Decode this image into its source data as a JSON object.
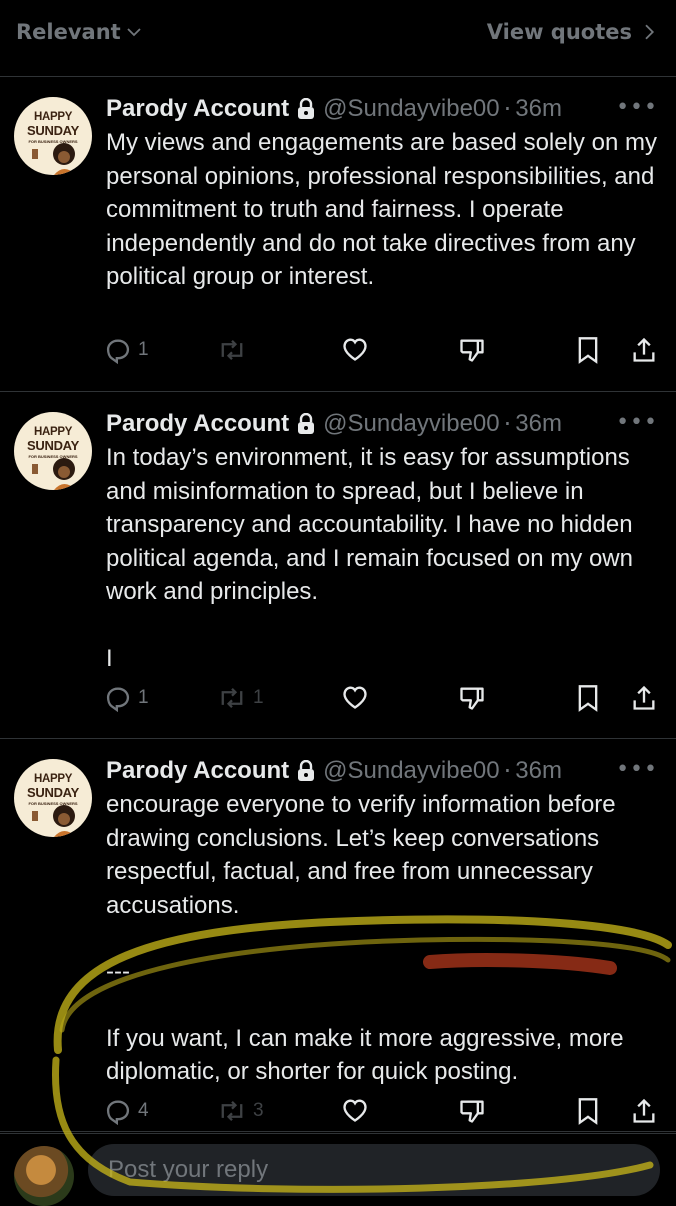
{
  "topbar": {
    "sort_label": "Relevant",
    "view_quotes_label": "View quotes"
  },
  "avatar": {
    "line1": "HAPPY",
    "line2": "SUNDAY",
    "line3": "FOR BUSINESS OWNERS"
  },
  "posts": [
    {
      "name": "Parody Account",
      "handle": "@Sundayvibe00",
      "sep": "·",
      "time": "36m",
      "paragraphs": [
        "My views and engagements are based solely on my personal opinions, professional responsibilities, and commitment to truth and fairness. I operate independently and do not take directives from any political group or interest."
      ],
      "replies": "1",
      "reposts": "",
      "likes": ""
    },
    {
      "name": "Parody Account",
      "handle": "@Sundayvibe00",
      "sep": "·",
      "time": "36m",
      "paragraphs": [
        "In today’s environment, it is easy for assumptions and misinformation to spread, but I believe in transparency and accountability. I have no hidden political agenda, and I remain focused on my own work and principles.",
        "I"
      ],
      "replies": "1",
      "reposts": "1",
      "likes": ""
    },
    {
      "name": "Parody Account",
      "handle": "@Sundayvibe00",
      "sep": "·",
      "time": "36m",
      "paragraphs": [
        "encourage everyone to verify information before drawing conclusions. Let’s keep conversations respectful, factual, and free from unnecessary accusations.",
        "---",
        "If you want, I can make it more aggressive, more diplomatic, or shorter for quick posting."
      ],
      "replies": "4",
      "reposts": "3",
      "likes": ""
    }
  ],
  "reply": {
    "placeholder": "Post your reply"
  },
  "colors": {
    "background": "#000000",
    "text": "#e7e9ea",
    "muted": "#71767b",
    "highlight": "#d4c21a"
  }
}
